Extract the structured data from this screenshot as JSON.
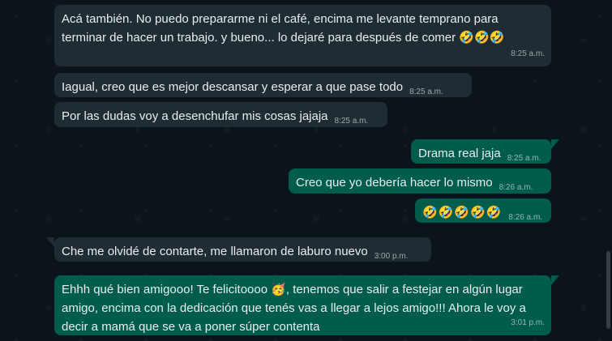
{
  "messages": [
    {
      "direction": "in",
      "text": "Acá también. No puedo prepararme ni el café, encima me levante temprano para terminar de hacer un trabajo. y bueno... lo dejaré para después de comer 🤣🤣🤣",
      "time": "8:25 a.m."
    },
    {
      "direction": "in",
      "text": "Iagual, creo que es mejor descansar y esperar a que pase todo",
      "time": "8:25 a.m."
    },
    {
      "direction": "in",
      "text": "Por las dudas voy a desenchufar mis cosas jajaja",
      "time": "8:25 a.m."
    },
    {
      "direction": "out",
      "text": "Drama real jaja",
      "time": "8:25 a.m."
    },
    {
      "direction": "out",
      "text": "Creo que yo debería hacer lo mismo",
      "time": "8:26 a.m."
    },
    {
      "direction": "out",
      "text": "🤣🤣🤣🤣🤣",
      "time": "8:26 a.m."
    },
    {
      "direction": "in",
      "text": "Che me olvidé de contarte, me llamaron de laburo nuevo",
      "time": "3:00 p.m."
    },
    {
      "direction": "out",
      "text": "Ehhh qué bien amigooo! Te felicitoooo 🥳, tenemos que salir a festejar en algún lugar amigo, encima con la dedicación que tenés vas a llegar a lejos amigo!!! Ahora le voy a decir a mamá que se va a poner súper contenta",
      "time": "3:01 p.m."
    }
  ],
  "colors": {
    "background": "#0b141a",
    "incoming_bubble": "#202c33",
    "outgoing_bubble": "#005c4b",
    "text": "#e9edef"
  }
}
